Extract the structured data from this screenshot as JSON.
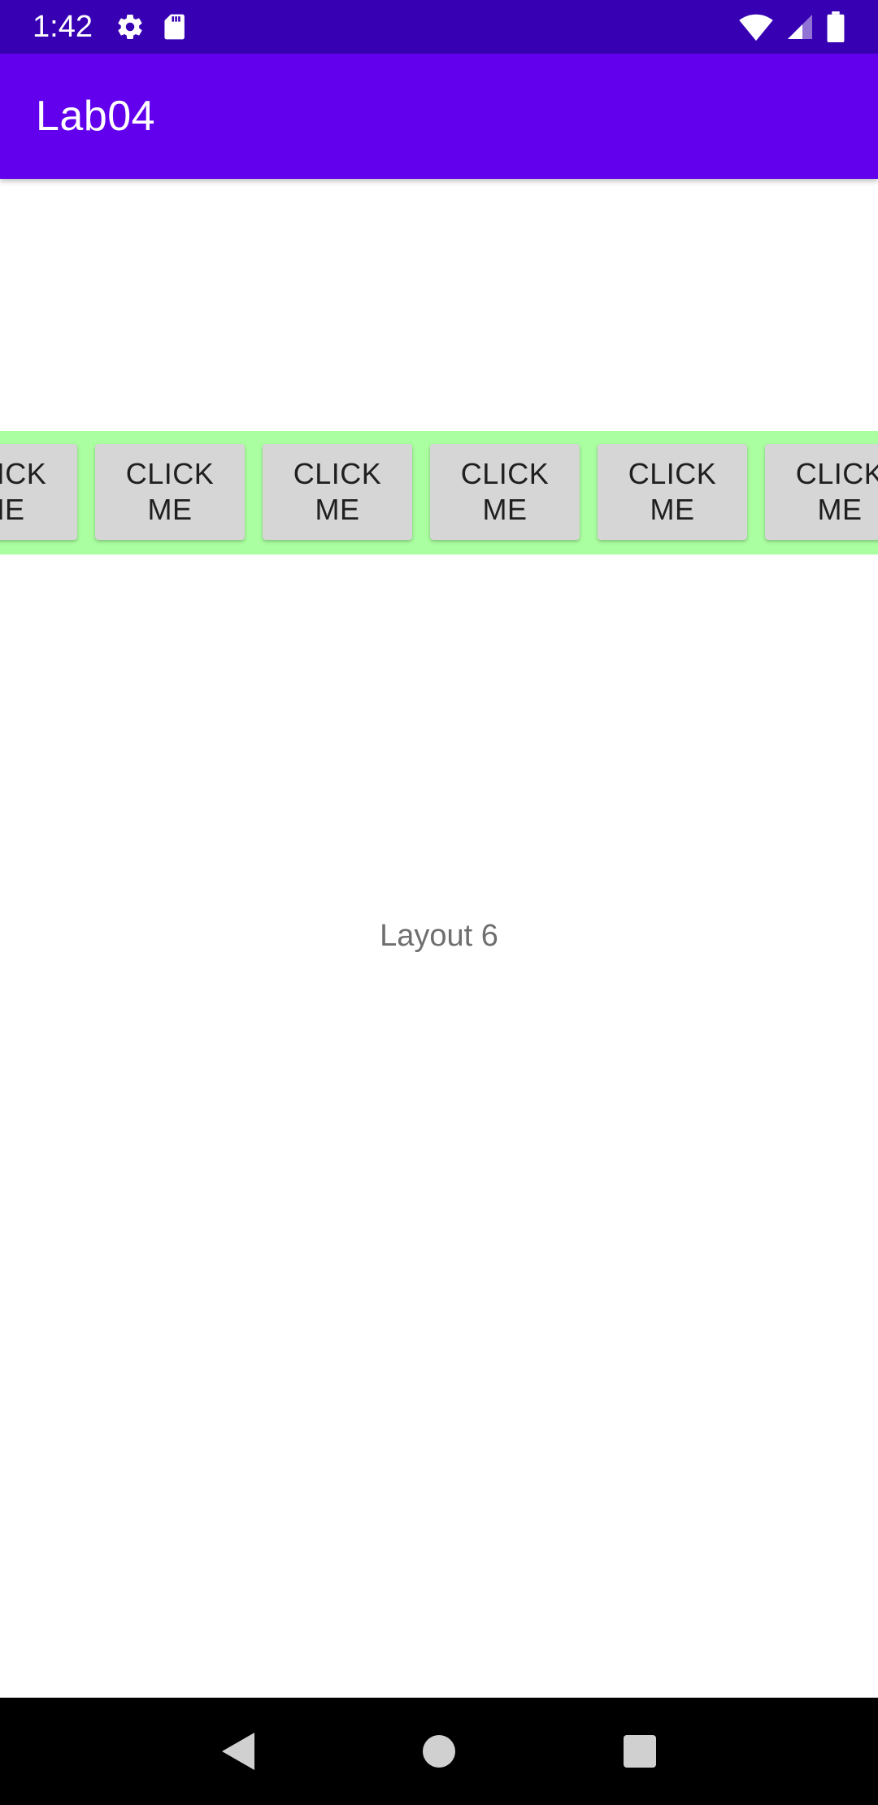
{
  "status_bar": {
    "time": "1:42",
    "icons": [
      "gear-icon",
      "sd-card-icon",
      "wifi-icon",
      "signal-icon",
      "battery-icon"
    ]
  },
  "app_bar": {
    "title": "Lab04"
  },
  "buttons": [
    {
      "label": "CLICK\nME"
    },
    {
      "label": "CLICK\nME"
    },
    {
      "label": "CLICK\nME"
    },
    {
      "label": "CLICK\nME"
    },
    {
      "label": "CLICK\nME"
    },
    {
      "label": "CLICK\nME"
    }
  ],
  "main": {
    "label": "Layout 6"
  },
  "colors": {
    "status_bar": "#3700B3",
    "app_bar": "#6200EE",
    "strip_background": "#AAFFA0",
    "button_background": "#D6D6D6"
  },
  "nav_bar": {
    "icons": [
      "back-icon",
      "home-icon",
      "recents-icon"
    ]
  }
}
